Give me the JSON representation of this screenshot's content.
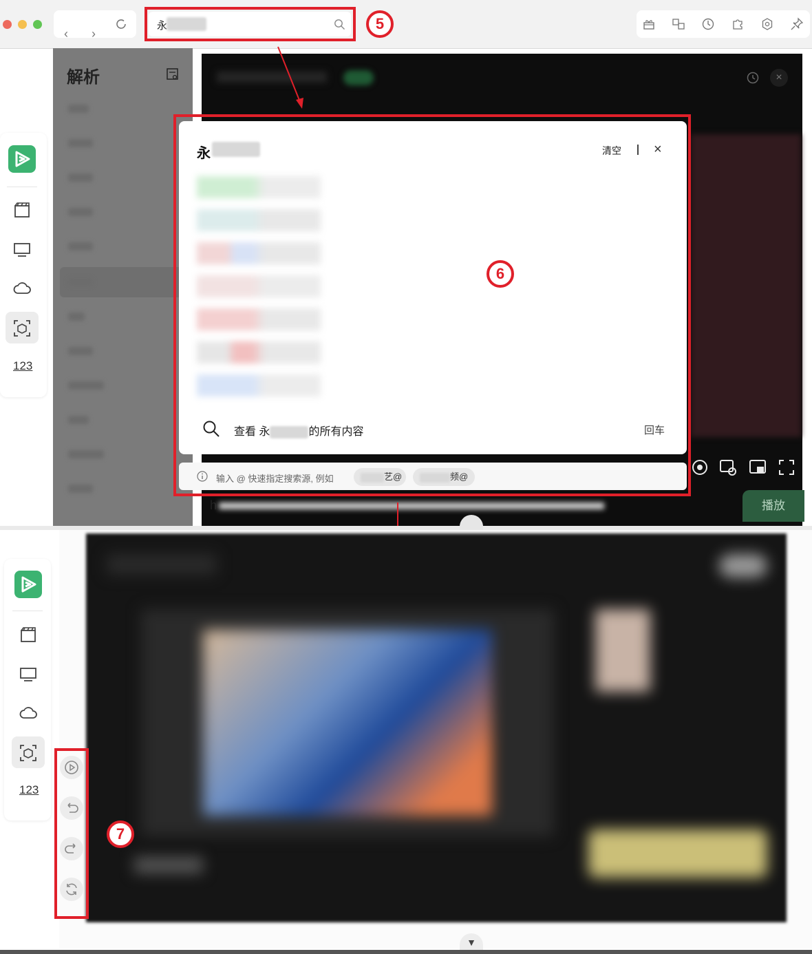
{
  "browser": {
    "url_text": "永",
    "toolbar_icons": [
      "gift-icon",
      "translate-icon",
      "history-icon",
      "puzzle-icon",
      "settings-icon",
      "pin-icon"
    ]
  },
  "annotations": {
    "five": "5",
    "six": "6",
    "seven": "7"
  },
  "left_panel": {
    "title": "解析"
  },
  "search_popup": {
    "query": "永",
    "clear_label": "清空",
    "close_glyph": "×",
    "view_all_prefix": "查看 永",
    "view_all_suffix": "的所有内容",
    "enter_hint": "回车"
  },
  "search_tip": {
    "text": "输入 @ 快速指定搜索源, 例如",
    "chips": [
      "艺@",
      "频@"
    ]
  },
  "player": {
    "play_label": "播放",
    "fragment": "h"
  },
  "sidebar": {
    "items": [
      "clapperboard-icon",
      "tv-icon",
      "cloud-icon",
      "cube-scan-icon",
      "numbers-icon"
    ],
    "numbers_label": "123"
  },
  "floating_controls": [
    "play-circle-icon",
    "undo-icon",
    "redo-icon",
    "refresh-icon"
  ],
  "colors": {
    "annotation_red": "#e0202a",
    "brand_green": "#3cb371"
  }
}
